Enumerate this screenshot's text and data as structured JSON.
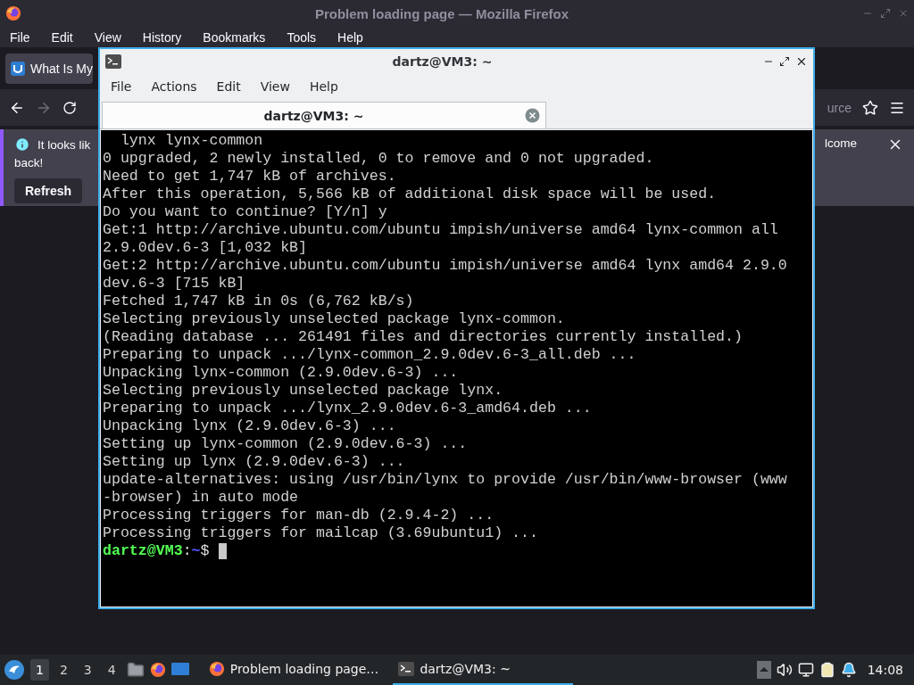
{
  "firefox": {
    "title": "Problem loading page — Mozilla Firefox",
    "menu": [
      "File",
      "Edit",
      "View",
      "History",
      "Bookmarks",
      "Tools",
      "Help"
    ],
    "tabs": [
      {
        "label": "What Is My",
        "selected": true
      }
    ],
    "url_text": "urce",
    "notification": {
      "text_start": "It looks lik",
      "text_end": "lcome",
      "text_second_line": "back!",
      "button": "Refresh"
    }
  },
  "terminal": {
    "title": "dartz@VM3: ~",
    "menu": [
      "File",
      "Actions",
      "Edit",
      "View",
      "Help"
    ],
    "tabs": [
      {
        "label": "dartz@VM3: ~",
        "selected": true
      }
    ],
    "lines": [
      "  lynx lynx-common",
      "0 upgraded, 2 newly installed, 0 to remove and 0 not upgraded.",
      "Need to get 1,747 kB of archives.",
      "After this operation, 5,566 kB of additional disk space will be used.",
      "Do you want to continue? [Y/n] y",
      "Get:1 http://archive.ubuntu.com/ubuntu impish/universe amd64 lynx-common all",
      "2.9.0dev.6-3 [1,032 kB]",
      "Get:2 http://archive.ubuntu.com/ubuntu impish/universe amd64 lynx amd64 2.9.0",
      "dev.6-3 [715 kB]",
      "Fetched 1,747 kB in 0s (6,762 kB/s)",
      "Selecting previously unselected package lynx-common.",
      "(Reading database ... 261491 files and directories currently installed.)",
      "Preparing to unpack .../lynx-common_2.9.0dev.6-3_all.deb ...",
      "Unpacking lynx-common (2.9.0dev.6-3) ...",
      "Selecting previously unselected package lynx.",
      "Preparing to unpack .../lynx_2.9.0dev.6-3_amd64.deb ...",
      "Unpacking lynx (2.9.0dev.6-3) ...",
      "Setting up lynx-common (2.9.0dev.6-3) ...",
      "Setting up lynx (2.9.0dev.6-3) ...",
      "update-alternatives: using /usr/bin/lynx to provide /usr/bin/www-browser (www",
      "-browser) in auto mode",
      "Processing triggers for man-db (2.9.4-2) ...",
      "Processing triggers for mailcap (3.69ubuntu1) ..."
    ],
    "prompt": {
      "user_host": "dartz@VM3",
      "separator": ":",
      "path": "~",
      "symbol": "$"
    }
  },
  "taskbar": {
    "workspaces": [
      {
        "label": "1",
        "selected": true
      },
      {
        "label": "2",
        "selected": false
      },
      {
        "label": "3",
        "selected": false
      },
      {
        "label": "4",
        "selected": false
      }
    ],
    "tasks": [
      {
        "kind": "firefox",
        "label": "Problem loading page…",
        "selected": false
      },
      {
        "kind": "terminal",
        "label": "dartz@VM3: ~",
        "selected": true
      }
    ],
    "clock": "14:08"
  }
}
